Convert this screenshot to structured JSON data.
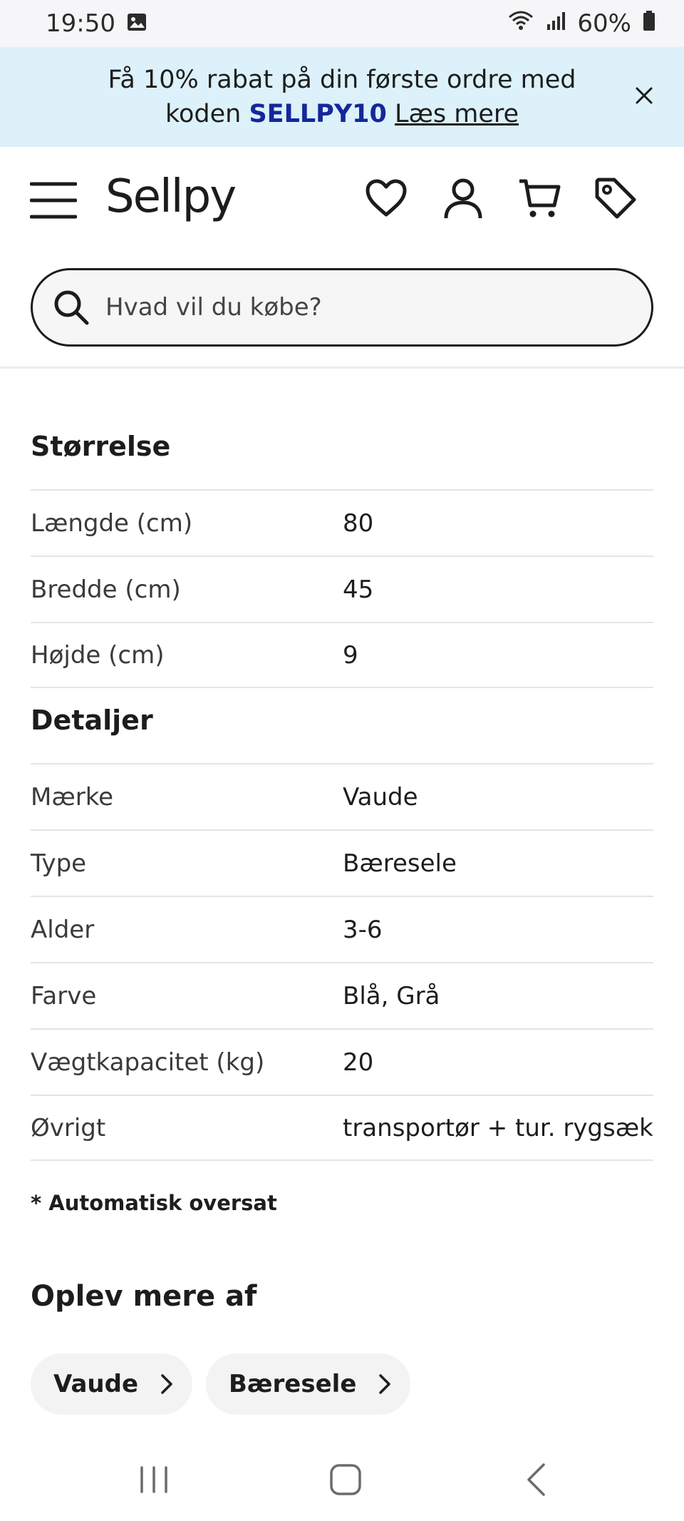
{
  "status_bar": {
    "time": "19:50",
    "battery": "60%"
  },
  "promo": {
    "text_line1": "Få 10% rabat på din første ordre med",
    "text_prefix": "koden ",
    "code": "SELLPY10",
    "link": "Læs mere"
  },
  "header": {
    "logo": "Sellpy"
  },
  "search": {
    "placeholder": "Hvad vil du købe?"
  },
  "size_section": {
    "title": "Størrelse",
    "rows": [
      {
        "label": "Længde (cm)",
        "value": "80"
      },
      {
        "label": "Bredde (cm)",
        "value": "45"
      },
      {
        "label": "Højde (cm)",
        "value": "9"
      }
    ]
  },
  "details_section": {
    "title": "Detaljer",
    "rows": [
      {
        "label": "Mærke",
        "value": "Vaude"
      },
      {
        "label": "Type",
        "value": "Bæresele"
      },
      {
        "label": "Alder",
        "value": "3-6"
      },
      {
        "label": "Farve",
        "value": "Blå, Grå"
      },
      {
        "label": "Vægtkapacitet (kg)",
        "value": "20"
      },
      {
        "label": "Øvrigt",
        "value": "transportør + tur. rygsæk"
      }
    ]
  },
  "note": "* Automatisk oversat",
  "explore": {
    "title": "Oplev mere af",
    "chips": [
      "Vaude",
      "Bæresele"
    ]
  },
  "colors": {
    "promo_bg": "#dcf1f9",
    "promo_code": "#15279b"
  }
}
